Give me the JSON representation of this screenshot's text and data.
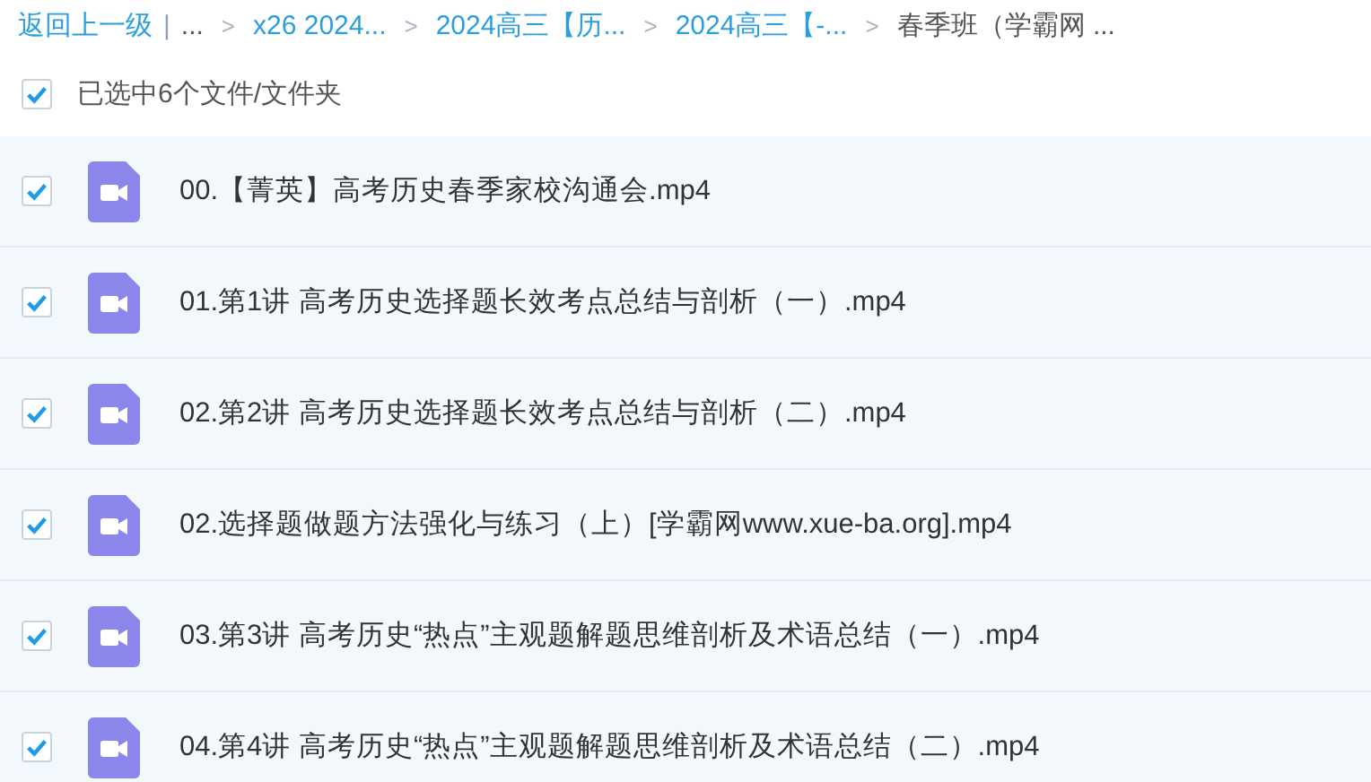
{
  "breadcrumb": {
    "back": "返回上一级",
    "separator": "|",
    "items": [
      {
        "label": "...",
        "kind": "plain"
      },
      {
        "label": "x26 2024...",
        "kind": "link"
      },
      {
        "label": "2024高三【历...",
        "kind": "link"
      },
      {
        "label": "2024高三【-...",
        "kind": "link"
      },
      {
        "label": "春季班（学霸网 ...",
        "kind": "current"
      }
    ],
    "chevron": ">"
  },
  "select_all": {
    "label": "已选中6个文件/文件夹",
    "checked": true
  },
  "files": [
    {
      "name": "00.【菁英】高考历史春季家校沟通会.mp4",
      "checked": true
    },
    {
      "name": "01.第1讲 高考历史选择题长效考点总结与剖析（一）.mp4",
      "checked": true
    },
    {
      "name": "02.第2讲 高考历史选择题长效考点总结与剖析（二）.mp4",
      "checked": true
    },
    {
      "name": "02.选择题做题方法强化与练习（上）[学霸网www.xue-ba.org].mp4",
      "checked": true
    },
    {
      "name": "03.第3讲 高考历史“热点”主观题解题思维剖析及术语总结（一）.mp4",
      "checked": true
    },
    {
      "name": "04.第4讲 高考历史“热点”主观题解题思维剖析及术语总结（二）.mp4",
      "checked": true
    }
  ]
}
